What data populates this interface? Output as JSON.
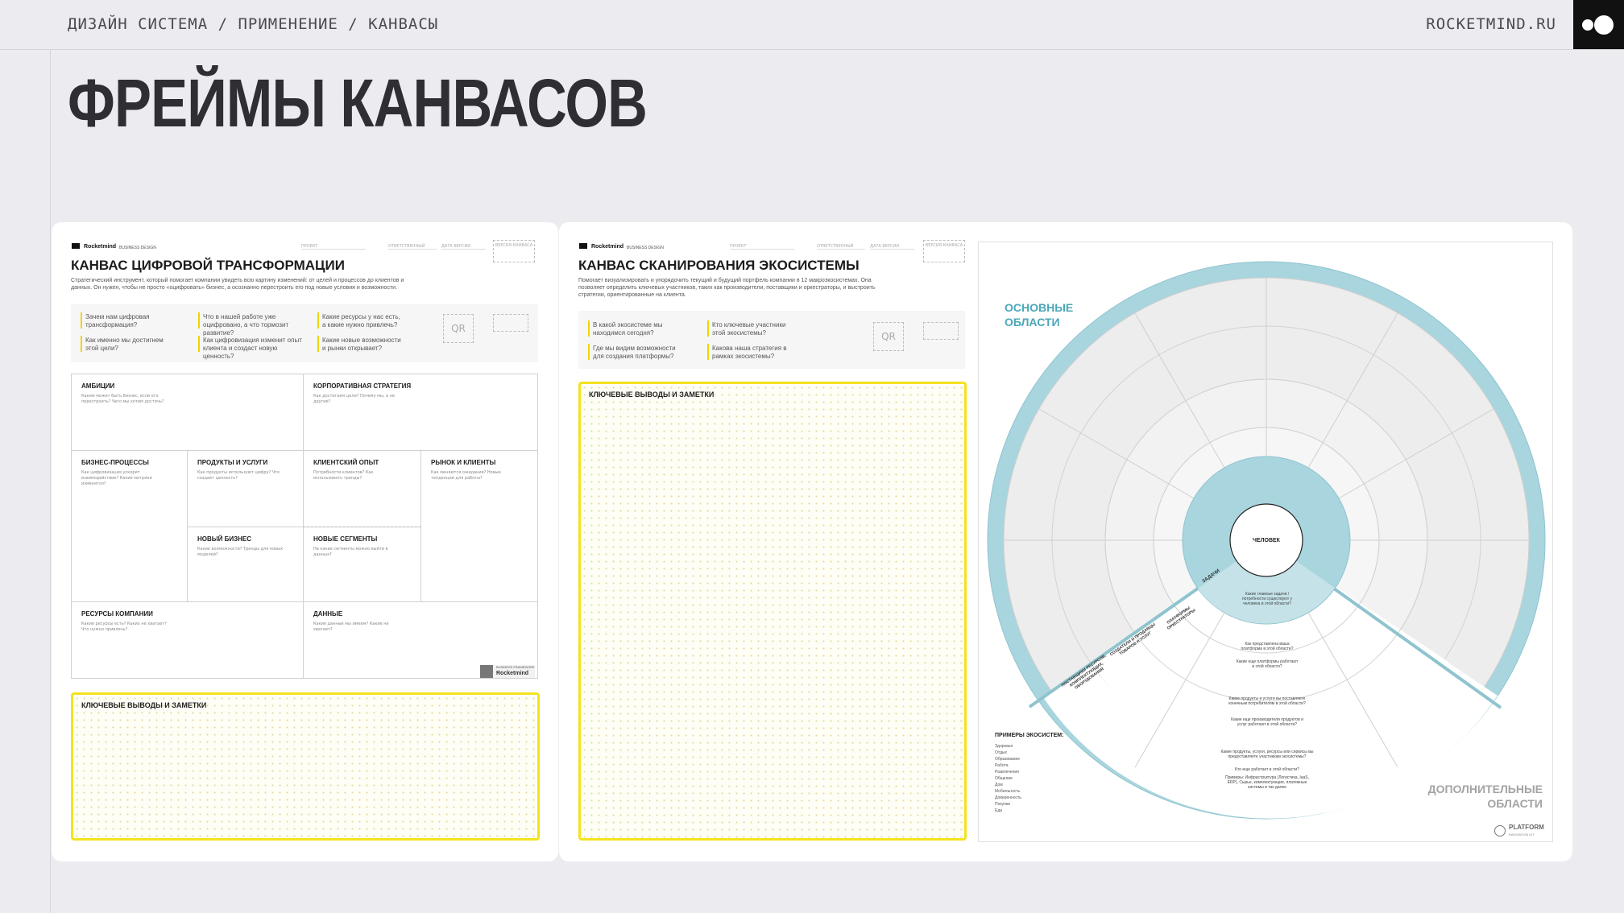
{
  "header": {
    "breadcrumb": "ДИЗАЙН СИСТЕМА / ПРИМЕНЕНИЕ / КАНВАСЫ",
    "site": "ROCKETMIND.RU"
  },
  "page_title": "ФРЕЙМЫ КАНВАСОВ",
  "colors": {
    "accent_teal": "#a7d3dc",
    "accent_yellow": "#f3e31c",
    "background": "#ecebef"
  },
  "canvas_digital": {
    "brand": "Rocketmind",
    "brand_sub": "BUSINESS DESIGN",
    "fields": [
      "ПРОЕКТ",
      "ОТВЕТСТВЕННЫЙ",
      "ДАТА ВЕРСИИ"
    ],
    "version_box": "ВЕРСИЯ КАНВАСА",
    "title": "КАНВАС ЦИФРОВОЙ ТРАНСФОРМАЦИИ",
    "description": "Стратегический инструмент, который помогает компании увидеть всю картину изменений: от целей и процессов до клиентов и данных. Он нужен, чтобы не просто «оцифровать» бизнес, а осознанно перестроить его под новые условия и возможности.",
    "questions": [
      "Зачем нам цифровая трансформация?",
      "Как именно мы достигнем этой цели?",
      "Что в нашей работе уже оцифровано, а что тормозит развитие?",
      "Как цифровизация изменит опыт клиента и создаст новую ценность?",
      "Какие ресурсы у нас есть, а какие нужно привлечь?",
      "Какие новые возможности и рынки открывает?"
    ],
    "qr": "QR",
    "blocks": {
      "ambitions": "АМБИЦИИ",
      "corporate_strategy": "КОРПОРАТИВНАЯ СТРАТЕГИЯ",
      "business_processes": "БИЗНЕС-ПРОЦЕССЫ",
      "products_services": "ПРОДУКТЫ И УСЛУГИ",
      "client_experience": "КЛИЕНТСКИЙ ОПЫТ",
      "market_clients": "РЫНОК И КЛИЕНТЫ",
      "new_business": "НОВЫЙ БИЗНЕС",
      "new_segments": "НОВЫЕ СЕГМЕНТЫ",
      "company_resources": "РЕСУРСЫ КОМПАНИИ",
      "data": "ДАННЫЕ"
    },
    "hints": {
      "ambitions": "Каким может быть бизнес, если его перестроить? Чего мы хотим достичь?",
      "corporate_strategy": "Как достигаем цели? Почему мы, а не другие?",
      "business_processes": "Как цифровизация ускорит взаимодействие? Какие метрики изменятся?",
      "products_services": "Как продукты используют цифру? Что создает ценность?",
      "client_experience": "Потребности клиентов? Как использовать тренды?",
      "market_clients": "Как меняются ожидания? Новые тенденции для работы?",
      "new_business": "Какие возможности? Тренды для новых моделей?",
      "new_segments": "На какие сегменты можно выйти в данных?",
      "company_resources": "Какие ресурсы есть? Каких не хватает? Что нужно привлечь?",
      "data": "Какие данные мы имеем? Какие не хватает?"
    },
    "badge_small": "BUSINESS FRAMEWORK",
    "badge_brand": "Rocketmind",
    "notes_label": "КЛЮЧЕВЫЕ ВЫВОДЫ И ЗАМЕТКИ"
  },
  "canvas_ecosystem": {
    "brand": "Rocketmind",
    "brand_sub": "BUSINESS DESIGN",
    "fields": [
      "ПРОЕКТ",
      "ОТВЕТСТВЕННЫЙ",
      "ДАТА ВЕРСИИ"
    ],
    "version_box": "ВЕРСИЯ КАНВАСА",
    "title": "КАНВАС СКАНИРОВАНИЯ ЭКОСИСТЕМЫ",
    "description": "Помогает визуализировать и упорядочить текущий и будущий портфель компании в 12 макроэкосистемах. Она позволяет определить ключевых участников, таких как производители, поставщики и оркестраторы, и выстроить стратегии, ориентированные на клиента.",
    "questions": [
      "В какой экосистеме мы находимся сегодня?",
      "Где мы видим возможности для создания платформы?",
      "Кто ключевые участники этой экосистемы?",
      "Какова наша стратегия в рамках экосистемы?"
    ],
    "qr": "QR",
    "notes_label": "КЛЮЧЕВЫЕ ВЫВОДЫ И ЗАМЕТКИ"
  },
  "wheel": {
    "main_areas": "ОСНОВНЫЕ ОБЛАСТИ",
    "extra_areas": "ДОПОЛНИТЕЛЬНЫЕ ОБЛАСТИ",
    "center": "ЧЕЛОВЕК",
    "tasks": "ЗАДАЧИ",
    "ring_labels": [
      "ПЛАТФОРМЫ ОРКЕСТРАТОРЫ",
      "СОЗДАТЕЛИ И ПРОДАВЦЫ ТОВАРОВ И УСЛУГ",
      "ПОСТАВЩИКИ РЕСУРСОВ, КОМПЛЕКТУЮЩИХ, ОБОРУДОВАНИЯ"
    ],
    "questions": [
      "Какие главные задачи / потребности существуют у человека в этой области?",
      "Как представлена ваша платформа в этой области?",
      "Какие еще платформы работают в этой области?",
      "Какие продукты и услуги вы поставляете конечным потребителям в этой области?",
      "Какие еще производители продуктов и услуг работают в этой области?",
      "Какие продукты, услуги, ресурсы или сервисы вы предоставляете участникам экосистемы?",
      "Кто еще работает в этой области?",
      "Примеры: Инфраструктура (Логистика, IaaS, ERP), Сырье, комплектующие, платежные системы и так далее"
    ],
    "examples_title": "ПРИМЕРЫ ЭКОСИСТЕМ:",
    "examples": [
      "Здоровье",
      "Отдых",
      "Образование",
      "Работа",
      "Развлечения",
      "Общение",
      "Дом",
      "Мобильность",
      "Доверенность",
      "Покупки",
      "Еда"
    ],
    "badge_title": "PLATFORM",
    "badge_sub": "INNOVATION KIT"
  }
}
